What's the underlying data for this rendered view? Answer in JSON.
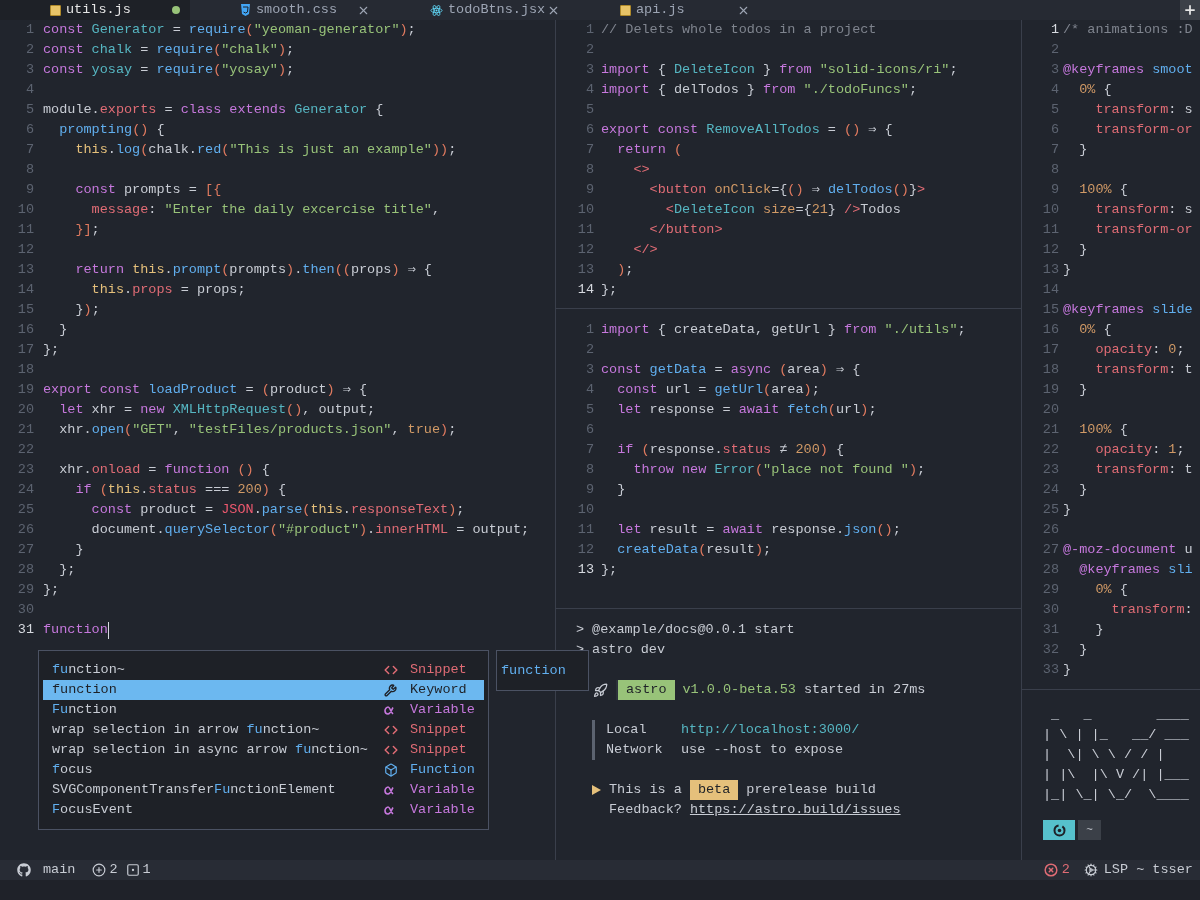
{
  "tabs": [
    {
      "label": "utils.js",
      "kind": "js",
      "selected": true,
      "modified": true
    },
    {
      "label": "smooth.css",
      "kind": "css",
      "selected": false,
      "modified": false
    },
    {
      "label": "todoBtns.jsx",
      "kind": "react",
      "selected": false,
      "modified": false
    },
    {
      "label": "api.js",
      "kind": "js",
      "selected": false,
      "modified": false
    }
  ],
  "left_editor": {
    "focused": true,
    "lines": [
      {
        "n": "1",
        "current": false,
        "tokens": [
          {
            "kind": "kw",
            "text": "const "
          },
          {
            "kind": "type",
            "text": "Generator"
          },
          {
            "kind": "punct",
            "text": " = "
          },
          {
            "kind": "fn",
            "text": "require"
          },
          {
            "kind": "paren",
            "text": "("
          },
          {
            "kind": "str",
            "text": "\"yeoman-generator\""
          },
          {
            "kind": "paren",
            "text": ")"
          },
          {
            "kind": "punct",
            "text": ";"
          }
        ]
      },
      {
        "n": "2",
        "current": false,
        "tokens": [
          {
            "kind": "kw",
            "text": "const "
          },
          {
            "kind": "type",
            "text": "chalk"
          },
          {
            "kind": "punct",
            "text": " = "
          },
          {
            "kind": "fn",
            "text": "require"
          },
          {
            "kind": "paren",
            "text": "("
          },
          {
            "kind": "str",
            "text": "\"chalk\""
          },
          {
            "kind": "paren",
            "text": ")"
          },
          {
            "kind": "punct",
            "text": ";"
          }
        ]
      },
      {
        "n": "3",
        "current": false,
        "tokens": [
          {
            "kind": "kw",
            "text": "const "
          },
          {
            "kind": "type",
            "text": "yosay"
          },
          {
            "kind": "punct",
            "text": " = "
          },
          {
            "kind": "fn",
            "text": "require"
          },
          {
            "kind": "paren",
            "text": "("
          },
          {
            "kind": "str",
            "text": "\"yosay\""
          },
          {
            "kind": "paren",
            "text": ")"
          },
          {
            "kind": "punct",
            "text": ";"
          }
        ]
      },
      {
        "n": "4",
        "current": false
      },
      {
        "n": "5",
        "current": false,
        "tokens": [
          {
            "kind": "name",
            "text": "module"
          },
          {
            "kind": "punct",
            "text": "."
          },
          {
            "kind": "prop",
            "text": "exports"
          },
          {
            "kind": "punct",
            "text": " = "
          },
          {
            "kind": "kw",
            "text": "class extends "
          },
          {
            "kind": "type",
            "text": "Generator"
          },
          {
            "kind": "punct",
            "text": " {"
          }
        ]
      },
      {
        "n": "6",
        "current": false,
        "tokens": [
          {
            "kind": "fn",
            "text": "  prompting"
          },
          {
            "kind": "paren",
            "text": "()"
          },
          {
            "kind": "punct",
            "text": " {"
          }
        ]
      },
      {
        "n": "7",
        "current": false,
        "tokens": [
          {
            "kind": "self",
            "text": "    this"
          },
          {
            "kind": "punct",
            "text": "."
          },
          {
            "kind": "fn",
            "text": "log"
          },
          {
            "kind": "paren",
            "text": "("
          },
          {
            "kind": "name",
            "text": "chalk"
          },
          {
            "kind": "punct",
            "text": "."
          },
          {
            "kind": "fn",
            "text": "red"
          },
          {
            "kind": "paren",
            "text": "("
          },
          {
            "kind": "str",
            "text": "\"This is just an example\""
          },
          {
            "kind": "paren",
            "text": "))"
          },
          {
            "kind": "punct",
            "text": ";"
          }
        ]
      },
      {
        "n": "8",
        "current": false
      },
      {
        "n": "9",
        "current": false,
        "tokens": [
          {
            "kind": "kw",
            "text": "    const "
          },
          {
            "kind": "name",
            "text": "prompts"
          },
          {
            "kind": "punct",
            "text": " = "
          },
          {
            "kind": "paren",
            "text": "[{"
          }
        ]
      },
      {
        "n": "10",
        "current": false,
        "tokens": [
          {
            "kind": "prop",
            "text": "      message"
          },
          {
            "kind": "punct",
            "text": ": "
          },
          {
            "kind": "str",
            "text": "\"Enter the daily excercise title\""
          },
          {
            "kind": "punct",
            "text": ","
          }
        ]
      },
      {
        "n": "11",
        "current": false,
        "tokens": [
          {
            "kind": "paren",
            "text": "    }]"
          },
          {
            "kind": "punct",
            "text": ";"
          }
        ]
      },
      {
        "n": "12",
        "current": false
      },
      {
        "n": "13",
        "current": false,
        "tokens": [
          {
            "kind": "kw",
            "text": "    return "
          },
          {
            "kind": "self",
            "text": "this"
          },
          {
            "kind": "punct",
            "text": "."
          },
          {
            "kind": "fn",
            "text": "prompt"
          },
          {
            "kind": "paren",
            "text": "("
          },
          {
            "kind": "name",
            "text": "prompts"
          },
          {
            "kind": "paren",
            "text": ")"
          },
          {
            "kind": "punct",
            "text": "."
          },
          {
            "kind": "fn",
            "text": "then"
          },
          {
            "kind": "paren",
            "text": "(("
          },
          {
            "kind": "name",
            "text": "props"
          },
          {
            "kind": "paren",
            "text": ")"
          },
          {
            "kind": "punct",
            "text": " ⇒ {"
          }
        ]
      },
      {
        "n": "14",
        "current": false,
        "tokens": [
          {
            "kind": "self",
            "text": "      this"
          },
          {
            "kind": "punct",
            "text": "."
          },
          {
            "kind": "prop",
            "text": "props"
          },
          {
            "kind": "punct",
            "text": " = "
          },
          {
            "kind": "name",
            "text": "props"
          },
          {
            "kind": "punct",
            "text": ";"
          }
        ]
      },
      {
        "n": "15",
        "current": false,
        "tokens": [
          {
            "kind": "punct",
            "text": "    }"
          },
          {
            "kind": "paren",
            "text": ")"
          },
          {
            "kind": "punct",
            "text": ";"
          }
        ]
      },
      {
        "n": "16",
        "current": false,
        "tokens": [
          {
            "kind": "punct",
            "text": "  }"
          }
        ]
      },
      {
        "n": "17",
        "current": false,
        "tokens": [
          {
            "kind": "punct",
            "text": "};"
          }
        ]
      },
      {
        "n": "18",
        "current": false
      },
      {
        "n": "19",
        "current": false,
        "tokens": [
          {
            "kind": "kw",
            "text": "export const "
          },
          {
            "kind": "fn",
            "text": "loadProduct"
          },
          {
            "kind": "punct",
            "text": " = "
          },
          {
            "kind": "paren",
            "text": "("
          },
          {
            "kind": "name",
            "text": "product"
          },
          {
            "kind": "paren",
            "text": ")"
          },
          {
            "kind": "punct",
            "text": " ⇒ {"
          }
        ]
      },
      {
        "n": "20",
        "current": false,
        "tokens": [
          {
            "kind": "kw",
            "text": "  let "
          },
          {
            "kind": "name",
            "text": "xhr"
          },
          {
            "kind": "punct",
            "text": " = "
          },
          {
            "kind": "kw",
            "text": "new "
          },
          {
            "kind": "type",
            "text": "XMLHttpRequest"
          },
          {
            "kind": "paren",
            "text": "()"
          },
          {
            "kind": "punct",
            "text": ", "
          },
          {
            "kind": "name",
            "text": "output"
          },
          {
            "kind": "punct",
            "text": ";"
          }
        ]
      },
      {
        "n": "21",
        "current": false,
        "tokens": [
          {
            "kind": "name",
            "text": "  xhr"
          },
          {
            "kind": "punct",
            "text": "."
          },
          {
            "kind": "fn",
            "text": "open"
          },
          {
            "kind": "paren",
            "text": "("
          },
          {
            "kind": "str",
            "text": "\"GET\""
          },
          {
            "kind": "punct",
            "text": ", "
          },
          {
            "kind": "str",
            "text": "\"testFiles/products.json\""
          },
          {
            "kind": "punct",
            "text": ", "
          },
          {
            "kind": "num",
            "text": "true"
          },
          {
            "kind": "paren",
            "text": ")"
          },
          {
            "kind": "punct",
            "text": ";"
          }
        ]
      },
      {
        "n": "22",
        "current": false
      },
      {
        "n": "23",
        "current": false,
        "tokens": [
          {
            "kind": "name",
            "text": "  xhr"
          },
          {
            "kind": "punct",
            "text": "."
          },
          {
            "kind": "prop",
            "text": "onload"
          },
          {
            "kind": "punct",
            "text": " = "
          },
          {
            "kind": "kw",
            "text": "function "
          },
          {
            "kind": "paren",
            "text": "()"
          },
          {
            "kind": "punct",
            "text": " {"
          }
        ]
      },
      {
        "n": "24",
        "current": false,
        "tokens": [
          {
            "kind": "kw",
            "text": "    if "
          },
          {
            "kind": "paren",
            "text": "("
          },
          {
            "kind": "self",
            "text": "this"
          },
          {
            "kind": "punct",
            "text": "."
          },
          {
            "kind": "prop",
            "text": "status"
          },
          {
            "kind": "punct",
            "text": " === "
          },
          {
            "kind": "num",
            "text": "200"
          },
          {
            "kind": "paren",
            "text": ")"
          },
          {
            "kind": "punct",
            "text": " {"
          }
        ]
      },
      {
        "n": "25",
        "current": false,
        "tokens": [
          {
            "kind": "kw",
            "text": "      const "
          },
          {
            "kind": "name",
            "text": "product"
          },
          {
            "kind": "punct",
            "text": " = "
          },
          {
            "kind": "builtin",
            "text": "JSON"
          },
          {
            "kind": "punct",
            "text": "."
          },
          {
            "kind": "fn",
            "text": "parse"
          },
          {
            "kind": "paren",
            "text": "("
          },
          {
            "kind": "self",
            "text": "this"
          },
          {
            "kind": "punct",
            "text": "."
          },
          {
            "kind": "prop",
            "text": "responseText"
          },
          {
            "kind": "paren",
            "text": ")"
          },
          {
            "kind": "punct",
            "text": ";"
          }
        ]
      },
      {
        "n": "26",
        "current": false,
        "tokens": [
          {
            "kind": "name",
            "text": "      document"
          },
          {
            "kind": "punct",
            "text": "."
          },
          {
            "kind": "fn",
            "text": "querySelector"
          },
          {
            "kind": "paren",
            "text": "("
          },
          {
            "kind": "str",
            "text": "\"#product\""
          },
          {
            "kind": "paren",
            "text": ")"
          },
          {
            "kind": "punct",
            "text": "."
          },
          {
            "kind": "prop",
            "text": "innerHTML"
          },
          {
            "kind": "punct",
            "text": " = "
          },
          {
            "kind": "name",
            "text": "output"
          },
          {
            "kind": "punct",
            "text": ";"
          }
        ]
      },
      {
        "n": "27",
        "current": false,
        "tokens": [
          {
            "kind": "punct",
            "text": "    }"
          }
        ]
      },
      {
        "n": "28",
        "current": false,
        "tokens": [
          {
            "kind": "punct",
            "text": "  };"
          }
        ]
      },
      {
        "n": "29",
        "current": false,
        "tokens": [
          {
            "kind": "punct",
            "text": "};"
          }
        ]
      },
      {
        "n": "30",
        "current": false
      },
      {
        "n": "31",
        "current": true,
        "tokens": [
          {
            "kind": "kw",
            "text": "function"
          }
        ]
      }
    ]
  },
  "completion": {
    "items": [
      {
        "label": "**fu**nction~",
        "kind": "snippet",
        "kind_label": "Snippet",
        "selected": false
      },
      {
        "label": "**fu**nction",
        "kind": "keyword",
        "kind_label": "Keyword",
        "selected": true
      },
      {
        "label": "**Fu**nction",
        "kind": "variable",
        "kind_label": "Variable",
        "selected": false
      },
      {
        "label": "wrap selection in arrow **fu**nction~",
        "kind": "snippet",
        "kind_label": "Snippet",
        "selected": false
      },
      {
        "label": "wrap selection in async arrow **fu**nction~",
        "kind": "snippet",
        "kind_label": "Snippet",
        "selected": false
      },
      {
        "label": "**f**ocus",
        "kind": "function",
        "kind_label": "Function",
        "selected": false
      },
      {
        "label": "SVGComponentTransfer**Fu**nctionElement",
        "kind": "variable",
        "kind_label": "Variable",
        "selected": false
      },
      {
        "label": "**F**ocusEvent",
        "kind": "variable",
        "kind_label": "Variable",
        "selected": false
      }
    ],
    "doc": "function"
  },
  "middle_top_editor": {
    "focused": false,
    "lines": [
      {
        "n": "1",
        "current": false,
        "tokens": [
          {
            "kind": "comment",
            "text": "// Delets whole todos in a project"
          }
        ]
      },
      {
        "n": "2",
        "current": false
      },
      {
        "n": "3",
        "current": false,
        "tokens": [
          {
            "kind": "kw",
            "text": "import "
          },
          {
            "kind": "punct",
            "text": "{ "
          },
          {
            "kind": "type",
            "text": "DeleteIcon"
          },
          {
            "kind": "punct",
            "text": " } "
          },
          {
            "kind": "kw",
            "text": "from "
          },
          {
            "kind": "str",
            "text": "\"solid-icons/ri\""
          },
          {
            "kind": "punct",
            "text": ";"
          }
        ]
      },
      {
        "n": "4",
        "current": false,
        "tokens": [
          {
            "kind": "kw",
            "text": "import "
          },
          {
            "kind": "punct",
            "text": "{ "
          },
          {
            "kind": "name",
            "text": "delTodos"
          },
          {
            "kind": "punct",
            "text": " } "
          },
          {
            "kind": "kw",
            "text": "from "
          },
          {
            "kind": "str",
            "text": "\"./todoFuncs\""
          },
          {
            "kind": "punct",
            "text": ";"
          }
        ]
      },
      {
        "n": "5",
        "current": false
      },
      {
        "n": "6",
        "current": false,
        "tokens": [
          {
            "kind": "kw",
            "text": "export const "
          },
          {
            "kind": "type",
            "text": "RemoveAllTodos"
          },
          {
            "kind": "punct",
            "text": " = "
          },
          {
            "kind": "paren",
            "text": "()"
          },
          {
            "kind": "punct",
            "text": " ⇒ {"
          }
        ]
      },
      {
        "n": "7",
        "current": false,
        "tokens": [
          {
            "kind": "kw",
            "text": "  return "
          },
          {
            "kind": "paren",
            "text": "("
          }
        ]
      },
      {
        "n": "8",
        "current": false,
        "tokens": [
          {
            "kind": "tag",
            "text": "    <>"
          }
        ]
      },
      {
        "n": "9",
        "current": false,
        "tokens": [
          {
            "kind": "tag",
            "text": "      <button "
          },
          {
            "kind": "attr",
            "text": "onClick"
          },
          {
            "kind": "punct",
            "text": "={"
          },
          {
            "kind": "paren",
            "text": "()"
          },
          {
            "kind": "punct",
            "text": " ⇒ "
          },
          {
            "kind": "fn",
            "text": "delTodos"
          },
          {
            "kind": "paren",
            "text": "()"
          },
          {
            "kind": "punct",
            "text": "}"
          },
          {
            "kind": "tag",
            "text": ">"
          }
        ]
      },
      {
        "n": "10",
        "current": false,
        "tokens": [
          {
            "kind": "tag",
            "text": "        <"
          },
          {
            "kind": "type",
            "text": "DeleteIcon "
          },
          {
            "kind": "attr",
            "text": "size"
          },
          {
            "kind": "punct",
            "text": "={"
          },
          {
            "kind": "num",
            "text": "21"
          },
          {
            "kind": "punct",
            "text": "} "
          },
          {
            "kind": "tag",
            "text": "/>"
          },
          {
            "kind": "name",
            "text": "Todos"
          }
        ]
      },
      {
        "n": "11",
        "current": false,
        "tokens": [
          {
            "kind": "tag",
            "text": "      </button>"
          }
        ]
      },
      {
        "n": "12",
        "current": false,
        "tokens": [
          {
            "kind": "tag",
            "text": "    </>"
          }
        ]
      },
      {
        "n": "13",
        "current": false,
        "tokens": [
          {
            "kind": "paren",
            "text": "  )"
          },
          {
            "kind": "punct",
            "text": ";"
          }
        ]
      },
      {
        "n": "14",
        "current": true,
        "tokens": [
          {
            "kind": "punct",
            "text": "};"
          }
        ]
      }
    ]
  },
  "middle_bottom_editor": {
    "focused": false,
    "lines": [
      {
        "n": "1",
        "current": false,
        "tokens": [
          {
            "kind": "kw",
            "text": "import "
          },
          {
            "kind": "punct",
            "text": "{ "
          },
          {
            "kind": "name",
            "text": "createData"
          },
          {
            "kind": "punct",
            "text": ", "
          },
          {
            "kind": "name",
            "text": "getUrl"
          },
          {
            "kind": "punct",
            "text": " } "
          },
          {
            "kind": "kw",
            "text": "from "
          },
          {
            "kind": "str",
            "text": "\"./utils\""
          },
          {
            "kind": "punct",
            "text": ";"
          }
        ]
      },
      {
        "n": "2",
        "current": false
      },
      {
        "n": "3",
        "current": false,
        "tokens": [
          {
            "kind": "kw",
            "text": "const "
          },
          {
            "kind": "fn",
            "text": "getData"
          },
          {
            "kind": "punct",
            "text": " = "
          },
          {
            "kind": "kw",
            "text": "async "
          },
          {
            "kind": "paren",
            "text": "("
          },
          {
            "kind": "name",
            "text": "area"
          },
          {
            "kind": "paren",
            "text": ")"
          },
          {
            "kind": "punct",
            "text": " ⇒ {"
          }
        ]
      },
      {
        "n": "4",
        "current": false,
        "tokens": [
          {
            "kind": "kw",
            "text": "  const "
          },
          {
            "kind": "name",
            "text": "url"
          },
          {
            "kind": "punct",
            "text": " = "
          },
          {
            "kind": "fn",
            "text": "getUrl"
          },
          {
            "kind": "paren",
            "text": "("
          },
          {
            "kind": "name",
            "text": "area"
          },
          {
            "kind": "paren",
            "text": ")"
          },
          {
            "kind": "punct",
            "text": ";"
          }
        ]
      },
      {
        "n": "5",
        "current": false,
        "tokens": [
          {
            "kind": "kw",
            "text": "  let "
          },
          {
            "kind": "name",
            "text": "response"
          },
          {
            "kind": "punct",
            "text": " = "
          },
          {
            "kind": "kw",
            "text": "await "
          },
          {
            "kind": "fn",
            "text": "fetch"
          },
          {
            "kind": "paren",
            "text": "("
          },
          {
            "kind": "name",
            "text": "url"
          },
          {
            "kind": "paren",
            "text": ")"
          },
          {
            "kind": "punct",
            "text": ";"
          }
        ]
      },
      {
        "n": "6",
        "current": false
      },
      {
        "n": "7",
        "current": false,
        "tokens": [
          {
            "kind": "kw",
            "text": "  if "
          },
          {
            "kind": "paren",
            "text": "("
          },
          {
            "kind": "name",
            "text": "response"
          },
          {
            "kind": "punct",
            "text": "."
          },
          {
            "kind": "prop",
            "text": "status"
          },
          {
            "kind": "punct",
            "text": " ≠ "
          },
          {
            "kind": "num",
            "text": "200"
          },
          {
            "kind": "paren",
            "text": ")"
          },
          {
            "kind": "punct",
            "text": " {"
          }
        ]
      },
      {
        "n": "8",
        "current": false,
        "tokens": [
          {
            "kind": "kw",
            "text": "    throw new "
          },
          {
            "kind": "type",
            "text": "Error"
          },
          {
            "kind": "paren",
            "text": "("
          },
          {
            "kind": "str",
            "text": "\"place not found \""
          },
          {
            "kind": "paren",
            "text": ")"
          },
          {
            "kind": "punct",
            "text": ";"
          }
        ]
      },
      {
        "n": "9",
        "current": false,
        "tokens": [
          {
            "kind": "punct",
            "text": "  }"
          }
        ]
      },
      {
        "n": "10",
        "current": false
      },
      {
        "n": "11",
        "current": false,
        "tokens": [
          {
            "kind": "kw",
            "text": "  let "
          },
          {
            "kind": "name",
            "text": "result"
          },
          {
            "kind": "punct",
            "text": " = "
          },
          {
            "kind": "kw",
            "text": "await "
          },
          {
            "kind": "name",
            "text": "response"
          },
          {
            "kind": "punct",
            "text": "."
          },
          {
            "kind": "fn",
            "text": "json"
          },
          {
            "kind": "paren",
            "text": "()"
          },
          {
            "kind": "punct",
            "text": ";"
          }
        ]
      },
      {
        "n": "12",
        "current": false,
        "tokens": [
          {
            "kind": "fn",
            "text": "  createData"
          },
          {
            "kind": "paren",
            "text": "("
          },
          {
            "kind": "name",
            "text": "result"
          },
          {
            "kind": "paren",
            "text": ")"
          },
          {
            "kind": "punct",
            "text": ";"
          }
        ]
      },
      {
        "n": "13",
        "current": true,
        "tokens": [
          {
            "kind": "punct",
            "text": "};"
          }
        ]
      }
    ]
  },
  "middle_terminal": {
    "commands": [
      {
        "prompt": ">",
        "text": "@example/docs@0.0.1 start"
      },
      {
        "prompt": ">",
        "text": "astro dev"
      }
    ],
    "banner": {
      "name": "astro",
      "version": "v1.0.0-beta.53",
      "message": "started in 27ms"
    },
    "addresses": [
      {
        "label": "Local",
        "value": "http://localhost:3000/",
        "kind": "link"
      },
      {
        "label": "Network",
        "value": "use --host to expose",
        "kind": "text"
      }
    ],
    "notice": {
      "before": "This is a",
      "badge": "beta",
      "after": "prerelease build"
    },
    "feedback": {
      "label": "Feedback?",
      "url": "https://astro.build/issues"
    }
  },
  "right_editor": {
    "focused": false,
    "lines": [
      {
        "n": "1",
        "current": true,
        "tokens": [
          {
            "kind": "comment",
            "text": "/* animations :D"
          }
        ]
      },
      {
        "n": "2",
        "current": false
      },
      {
        "n": "3",
        "current": false,
        "tokens": [
          {
            "kind": "kw",
            "text": "@keyframes "
          },
          {
            "kind": "fn",
            "text": "smoot"
          }
        ]
      },
      {
        "n": "4",
        "current": false,
        "tokens": [
          {
            "kind": "num",
            "text": "  0%"
          },
          {
            "kind": "punct",
            "text": " {"
          }
        ]
      },
      {
        "n": "5",
        "current": false,
        "tokens": [
          {
            "kind": "prop",
            "text": "    transform"
          },
          {
            "kind": "punct",
            "text": ": "
          },
          {
            "kind": "name",
            "text": "s"
          }
        ]
      },
      {
        "n": "6",
        "current": false,
        "tokens": [
          {
            "kind": "prop",
            "text": "    transform-or"
          }
        ]
      },
      {
        "n": "7",
        "current": false,
        "tokens": [
          {
            "kind": "punct",
            "text": "  }"
          }
        ]
      },
      {
        "n": "8",
        "current": false
      },
      {
        "n": "9",
        "current": false,
        "tokens": [
          {
            "kind": "num",
            "text": "  100%"
          },
          {
            "kind": "punct",
            "text": " {"
          }
        ]
      },
      {
        "n": "10",
        "current": false,
        "tokens": [
          {
            "kind": "prop",
            "text": "    transform"
          },
          {
            "kind": "punct",
            "text": ": "
          },
          {
            "kind": "name",
            "text": "s"
          }
        ]
      },
      {
        "n": "11",
        "current": false,
        "tokens": [
          {
            "kind": "prop",
            "text": "    transform-or"
          }
        ]
      },
      {
        "n": "12",
        "current": false,
        "tokens": [
          {
            "kind": "punct",
            "text": "  }"
          }
        ]
      },
      {
        "n": "13",
        "current": false,
        "tokens": [
          {
            "kind": "punct",
            "text": "}"
          }
        ]
      },
      {
        "n": "14",
        "current": false
      },
      {
        "n": "15",
        "current": false,
        "tokens": [
          {
            "kind": "kw",
            "text": "@keyframes "
          },
          {
            "kind": "fn",
            "text": "slide"
          }
        ]
      },
      {
        "n": "16",
        "current": false,
        "tokens": [
          {
            "kind": "num",
            "text": "  0%"
          },
          {
            "kind": "punct",
            "text": " {"
          }
        ]
      },
      {
        "n": "17",
        "current": false,
        "tokens": [
          {
            "kind": "prop",
            "text": "    opacity"
          },
          {
            "kind": "punct",
            "text": ": "
          },
          {
            "kind": "num",
            "text": "0"
          },
          {
            "kind": "punct",
            "text": ";"
          }
        ]
      },
      {
        "n": "18",
        "current": false,
        "tokens": [
          {
            "kind": "prop",
            "text": "    transform"
          },
          {
            "kind": "punct",
            "text": ": "
          },
          {
            "kind": "name",
            "text": "t"
          }
        ]
      },
      {
        "n": "19",
        "current": false,
        "tokens": [
          {
            "kind": "punct",
            "text": "  }"
          }
        ]
      },
      {
        "n": "20",
        "current": false
      },
      {
        "n": "21",
        "current": false,
        "tokens": [
          {
            "kind": "num",
            "text": "  100%"
          },
          {
            "kind": "punct",
            "text": " {"
          }
        ]
      },
      {
        "n": "22",
        "current": false,
        "tokens": [
          {
            "kind": "prop",
            "text": "    opacity"
          },
          {
            "kind": "punct",
            "text": ": "
          },
          {
            "kind": "num",
            "text": "1"
          },
          {
            "kind": "punct",
            "text": ";"
          }
        ]
      },
      {
        "n": "23",
        "current": false,
        "tokens": [
          {
            "kind": "prop",
            "text": "    transform"
          },
          {
            "kind": "punct",
            "text": ": "
          },
          {
            "kind": "name",
            "text": "t"
          }
        ]
      },
      {
        "n": "24",
        "current": false,
        "tokens": [
          {
            "kind": "punct",
            "text": "  }"
          }
        ]
      },
      {
        "n": "25",
        "current": false,
        "tokens": [
          {
            "kind": "punct",
            "text": "}"
          }
        ]
      },
      {
        "n": "26",
        "current": false
      },
      {
        "n": "27",
        "current": false,
        "tokens": [
          {
            "kind": "kw",
            "text": "@-moz-document "
          },
          {
            "kind": "name",
            "text": "u"
          }
        ]
      },
      {
        "n": "28",
        "current": false,
        "tokens": [
          {
            "kind": "kw",
            "text": "  @keyframes "
          },
          {
            "kind": "fn",
            "text": "sli"
          }
        ]
      },
      {
        "n": "29",
        "current": false,
        "tokens": [
          {
            "kind": "num",
            "text": "    0%"
          },
          {
            "kind": "punct",
            "text": " {"
          }
        ]
      },
      {
        "n": "30",
        "current": false,
        "tokens": [
          {
            "kind": "prop",
            "text": "      transform"
          },
          {
            "kind": "punct",
            "text": ":"
          }
        ]
      },
      {
        "n": "31",
        "current": false,
        "tokens": [
          {
            "kind": "punct",
            "text": "    }"
          }
        ]
      },
      {
        "n": "32",
        "current": false,
        "tokens": [
          {
            "kind": "punct",
            "text": "  }"
          }
        ]
      },
      {
        "n": "33",
        "current": false,
        "tokens": [
          {
            "kind": "punct",
            "text": "}"
          }
        ]
      }
    ]
  },
  "right_terminal": {
    "ascii_art": [
      " _   _        ____",
      "| \\ | |_   __/ ___",
      "|  \\| \\ \\ / / |",
      "| |\\  |\\ V /| |___",
      "|_| \\_| \\_/  \\____"
    ],
    "prompt_dir": "~"
  },
  "status_bar": {
    "branch": "main",
    "added": "2",
    "changed": "1",
    "errors": "2",
    "lsp": "LSP ~ tsser"
  }
}
